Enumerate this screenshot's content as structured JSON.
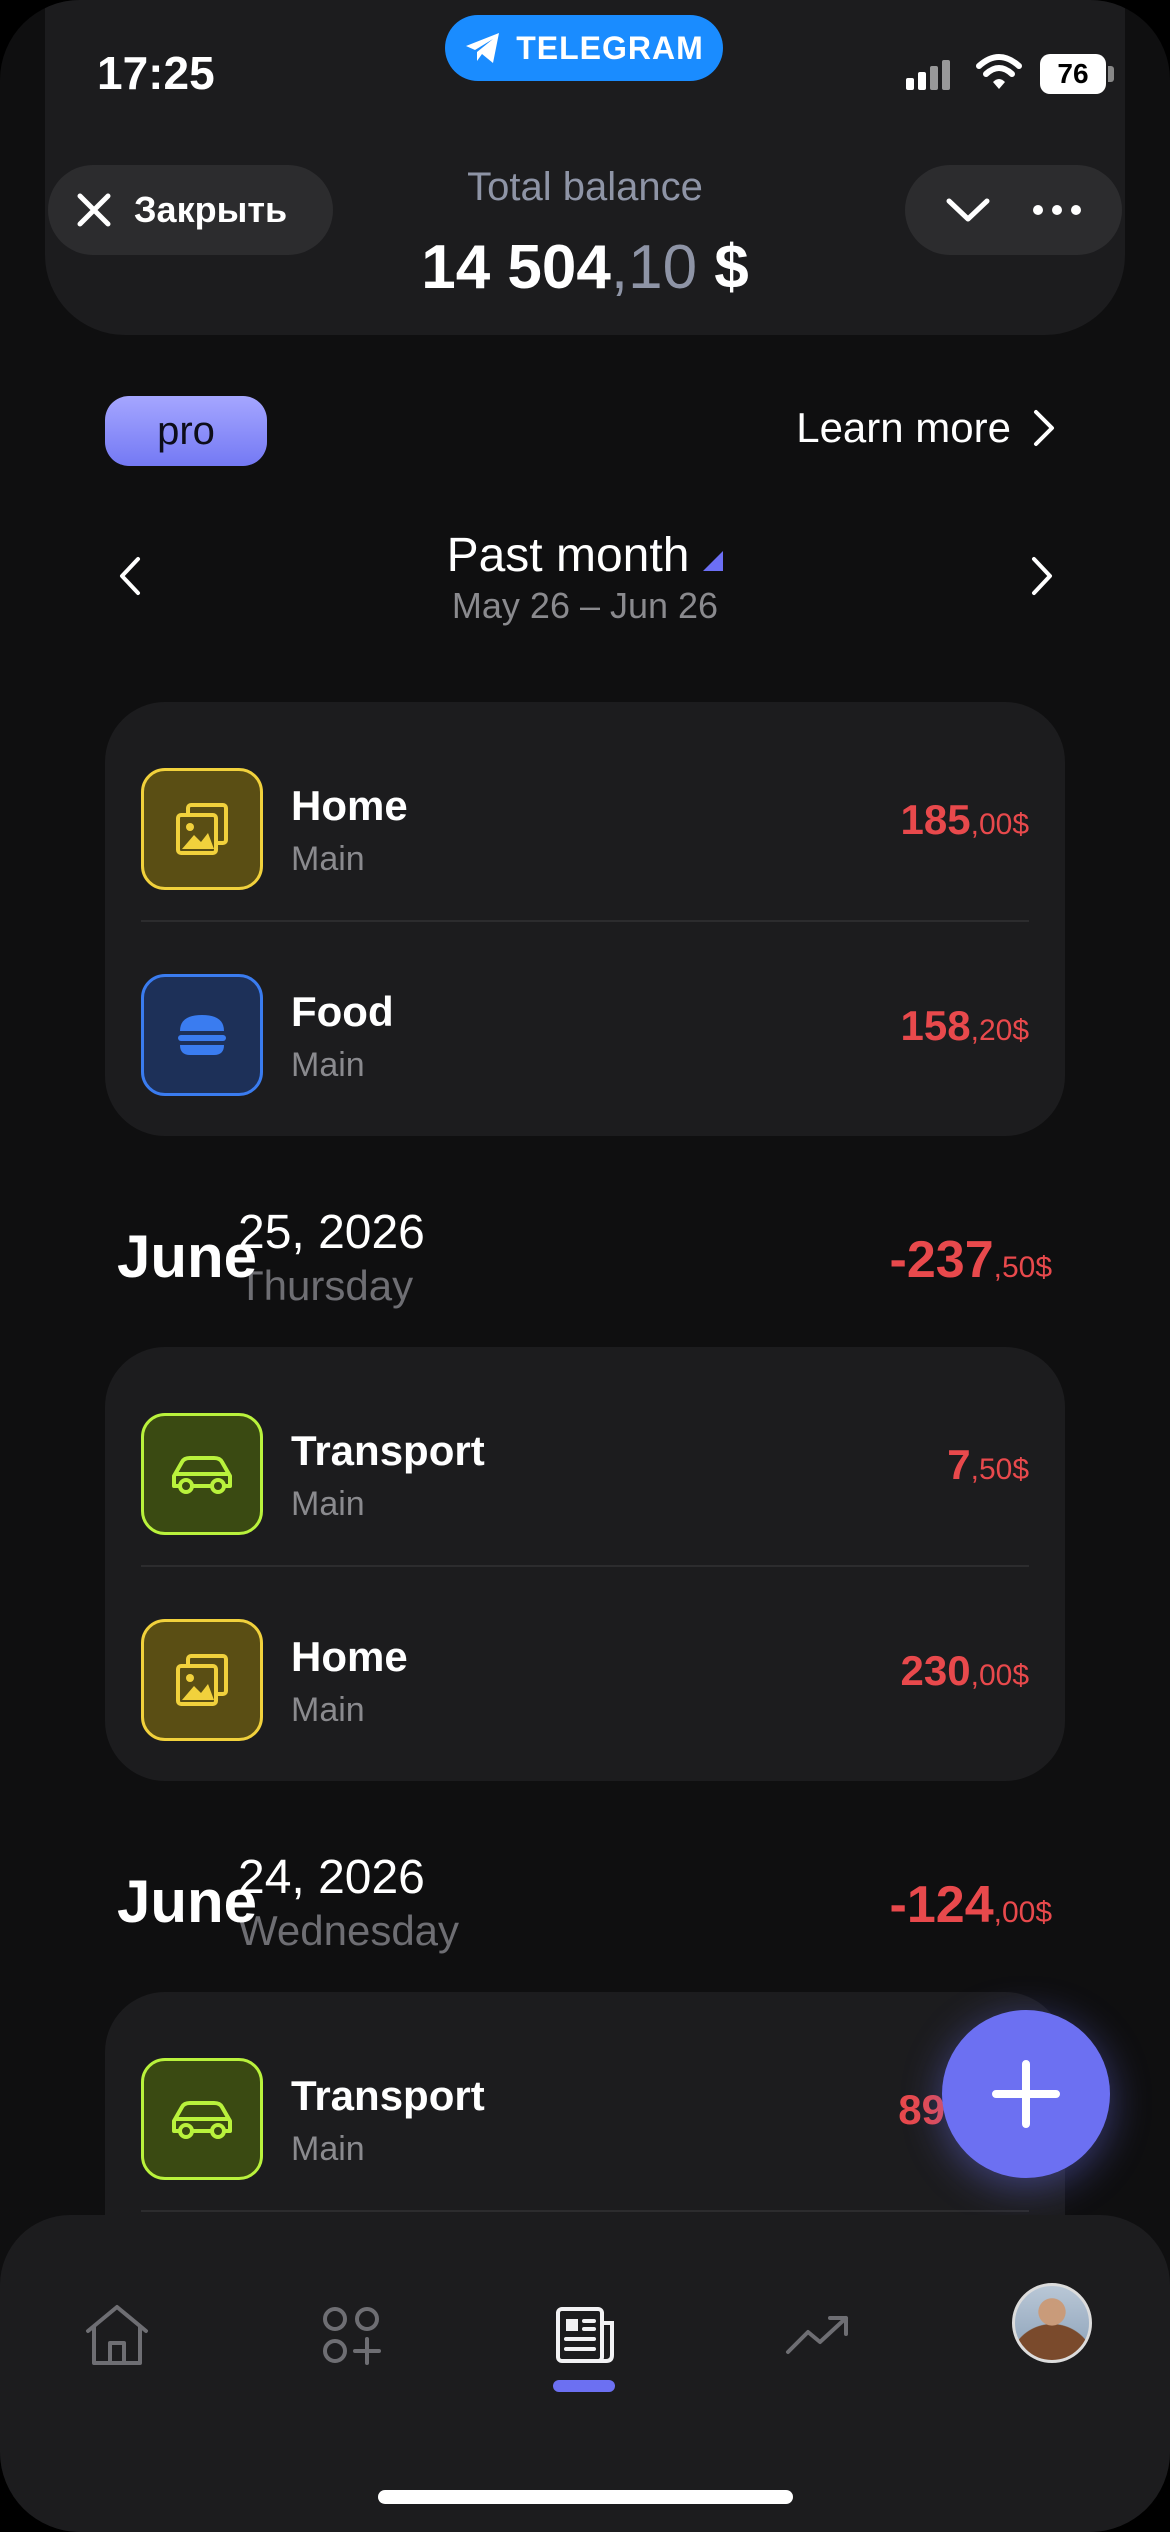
{
  "status": {
    "time": "17:25",
    "battery": "76",
    "telegram_label": "TELEGRAM"
  },
  "header": {
    "close_label": "Закрыть",
    "balance_label": "Total balance",
    "balance_main": "14 504",
    "balance_frac": ",10",
    "balance_currency": " $"
  },
  "pro": {
    "badge": "pro",
    "learn_more": "Learn more"
  },
  "period": {
    "title": "Past month",
    "range": "May 26 – Jun 26"
  },
  "groups": [
    {
      "items": [
        {
          "title": "Home",
          "sub": "Main",
          "amount": "185",
          "cents": ",00$",
          "icon": "image-icon"
        },
        {
          "title": "Food",
          "sub": "Main",
          "amount": "158",
          "cents": ",20$",
          "icon": "burger-icon"
        }
      ]
    },
    {
      "month": "June",
      "date": "25, 2026",
      "weekday": "Thursday",
      "total": "-237",
      "total_cents": ",50$",
      "items": [
        {
          "title": "Transport",
          "sub": "Main",
          "amount": "7",
          "cents": ",50$",
          "icon": "car-icon"
        },
        {
          "title": "Home",
          "sub": "Main",
          "amount": "230",
          "cents": ",00$",
          "icon": "image-icon"
        }
      ]
    },
    {
      "month": "June",
      "date": "24, 2026",
      "weekday": "Wednesday",
      "total": "-124",
      "total_cents": ",00$",
      "items": [
        {
          "title": "Transport",
          "sub": "Main",
          "amount": "89",
          "cents": "",
          "icon": "car-icon"
        }
      ]
    }
  ],
  "colors": {
    "accent": "#6c70f2",
    "expense": "#e8494c",
    "telegram": "#1a8cff"
  },
  "tabs": [
    "home-icon",
    "categories-icon",
    "transactions-icon",
    "analytics-icon",
    "profile-avatar"
  ]
}
